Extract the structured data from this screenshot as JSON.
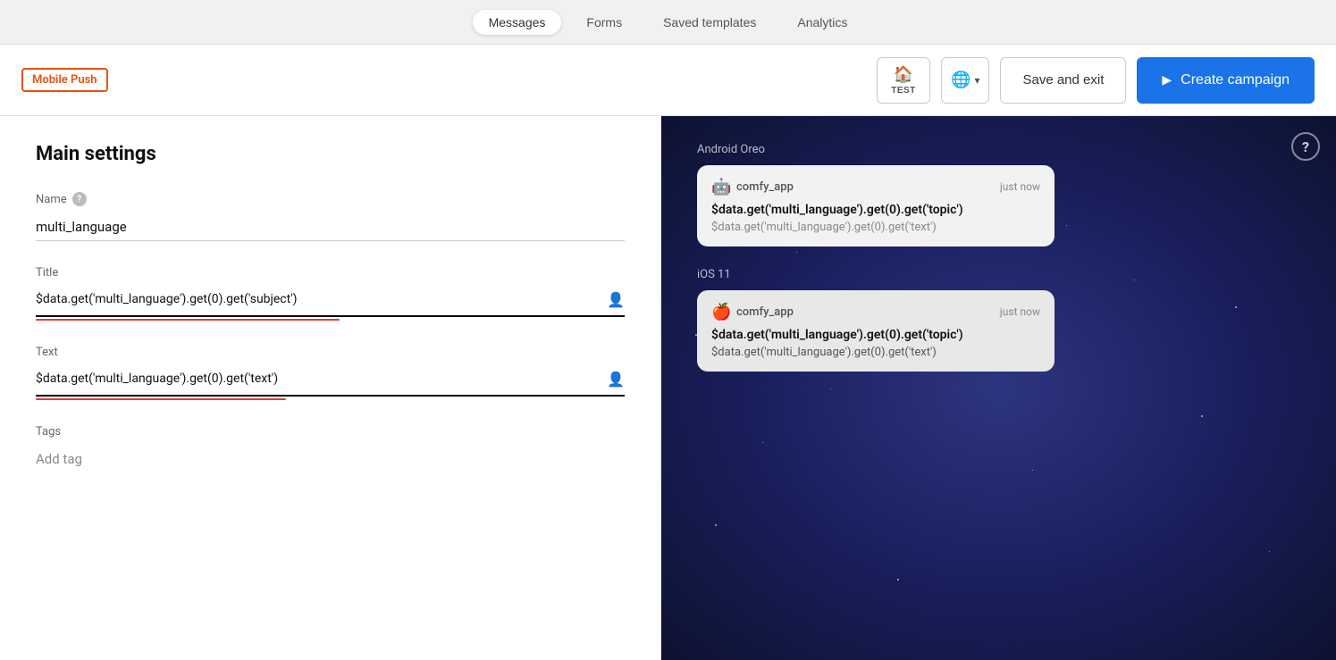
{
  "nav": {
    "tabs": [
      {
        "id": "messages",
        "label": "Messages",
        "active": true
      },
      {
        "id": "forms",
        "label": "Forms",
        "active": false
      },
      {
        "id": "saved-templates",
        "label": "Saved templates",
        "active": false
      },
      {
        "id": "analytics",
        "label": "Analytics",
        "active": false
      }
    ]
  },
  "toolbar": {
    "mobile_push_label": "Mobile Push",
    "test_label": "TEST",
    "save_exit_label": "Save and exit",
    "create_campaign_label": "Create campaign"
  },
  "main_settings": {
    "title": "Main settings",
    "name_label": "Name",
    "name_value": "multi_language",
    "title_label": "Title",
    "title_value": "$data.get('multi_language').get(0).get('subject')",
    "text_label": "Text",
    "text_value": "$data.get('multi_language').get(0).get('text')",
    "tags_label": "Tags",
    "tags_placeholder": "Add tag"
  },
  "preview": {
    "android_label": "Android Oreo",
    "android_app_name": "comfy_app",
    "android_time": "just now",
    "android_title": "$data.get('multi_language').get(0).get('topic')",
    "android_text": "$data.get('multi_language').get(0).get('text')",
    "ios_label": "iOS 11",
    "ios_app_name": "comfy_app",
    "ios_time": "just now",
    "ios_title": "$data.get('multi_language').get(0).get('topic')",
    "ios_text": "$data.get('multi_language').get(0).get('text')",
    "help_label": "?"
  }
}
